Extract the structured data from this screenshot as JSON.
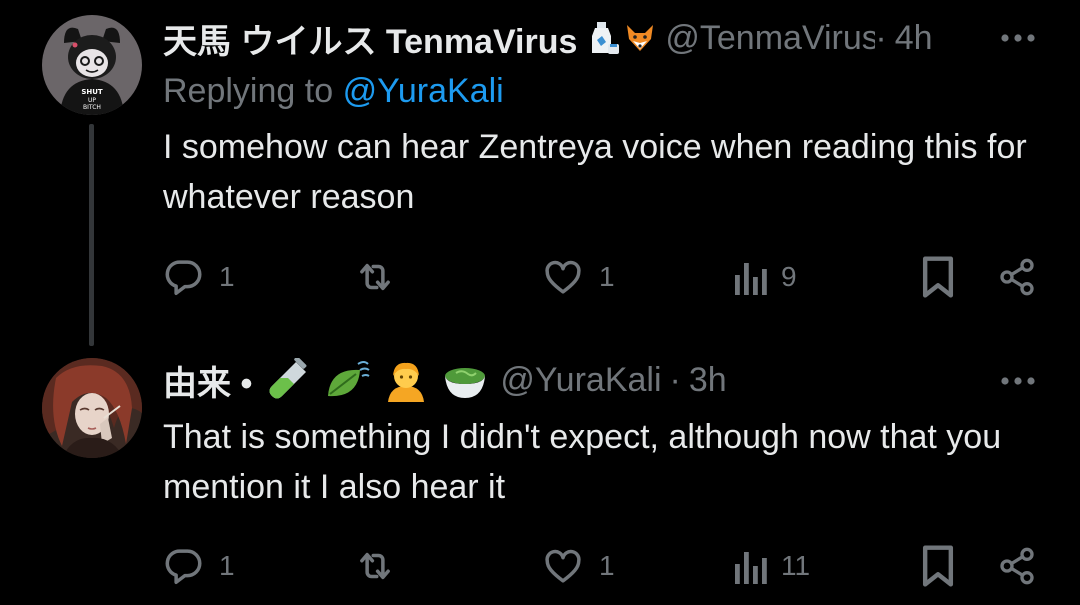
{
  "colors": {
    "background": "#000000",
    "text_primary": "#e7e9ea",
    "text_secondary": "#71767b",
    "link": "#1d9bf0",
    "thread_line": "#333639"
  },
  "tweets": [
    {
      "display_name": "天馬 ウイルス TenmaVirus",
      "name_emojis": [
        "sake-bottle-emoji",
        "fox-emoji"
      ],
      "handle": "@TenmaVirus",
      "separator": "·",
      "time": "4h",
      "replying_prefix": "Replying to",
      "replying_to": "@YuraKali",
      "text": "I somehow can hear Zentreya voice when reading this for whatever reason",
      "avatar_caption": "SHUT UP BITCH",
      "actions": {
        "replies": "1",
        "retweets": "",
        "likes": "1",
        "views": "9"
      }
    },
    {
      "display_name": "由来 •",
      "name_emojis": [
        "test-tube-emoji",
        "leaf-wind-emoji",
        "person-emoji",
        "matcha-emoji"
      ],
      "handle": "@YuraKali",
      "separator": "·",
      "time": "3h",
      "text": "That is something I didn't expect, although now that you mention it I also hear it",
      "actions": {
        "replies": "1",
        "retweets": "",
        "likes": "1",
        "views": "11"
      }
    }
  ],
  "icons": {
    "more": "more-dots-icon",
    "reply": "reply-bubble-icon",
    "retweet": "retweet-icon",
    "like": "heart-icon",
    "views": "views-chart-icon",
    "bookmark": "bookmark-icon",
    "share": "share-icon"
  }
}
